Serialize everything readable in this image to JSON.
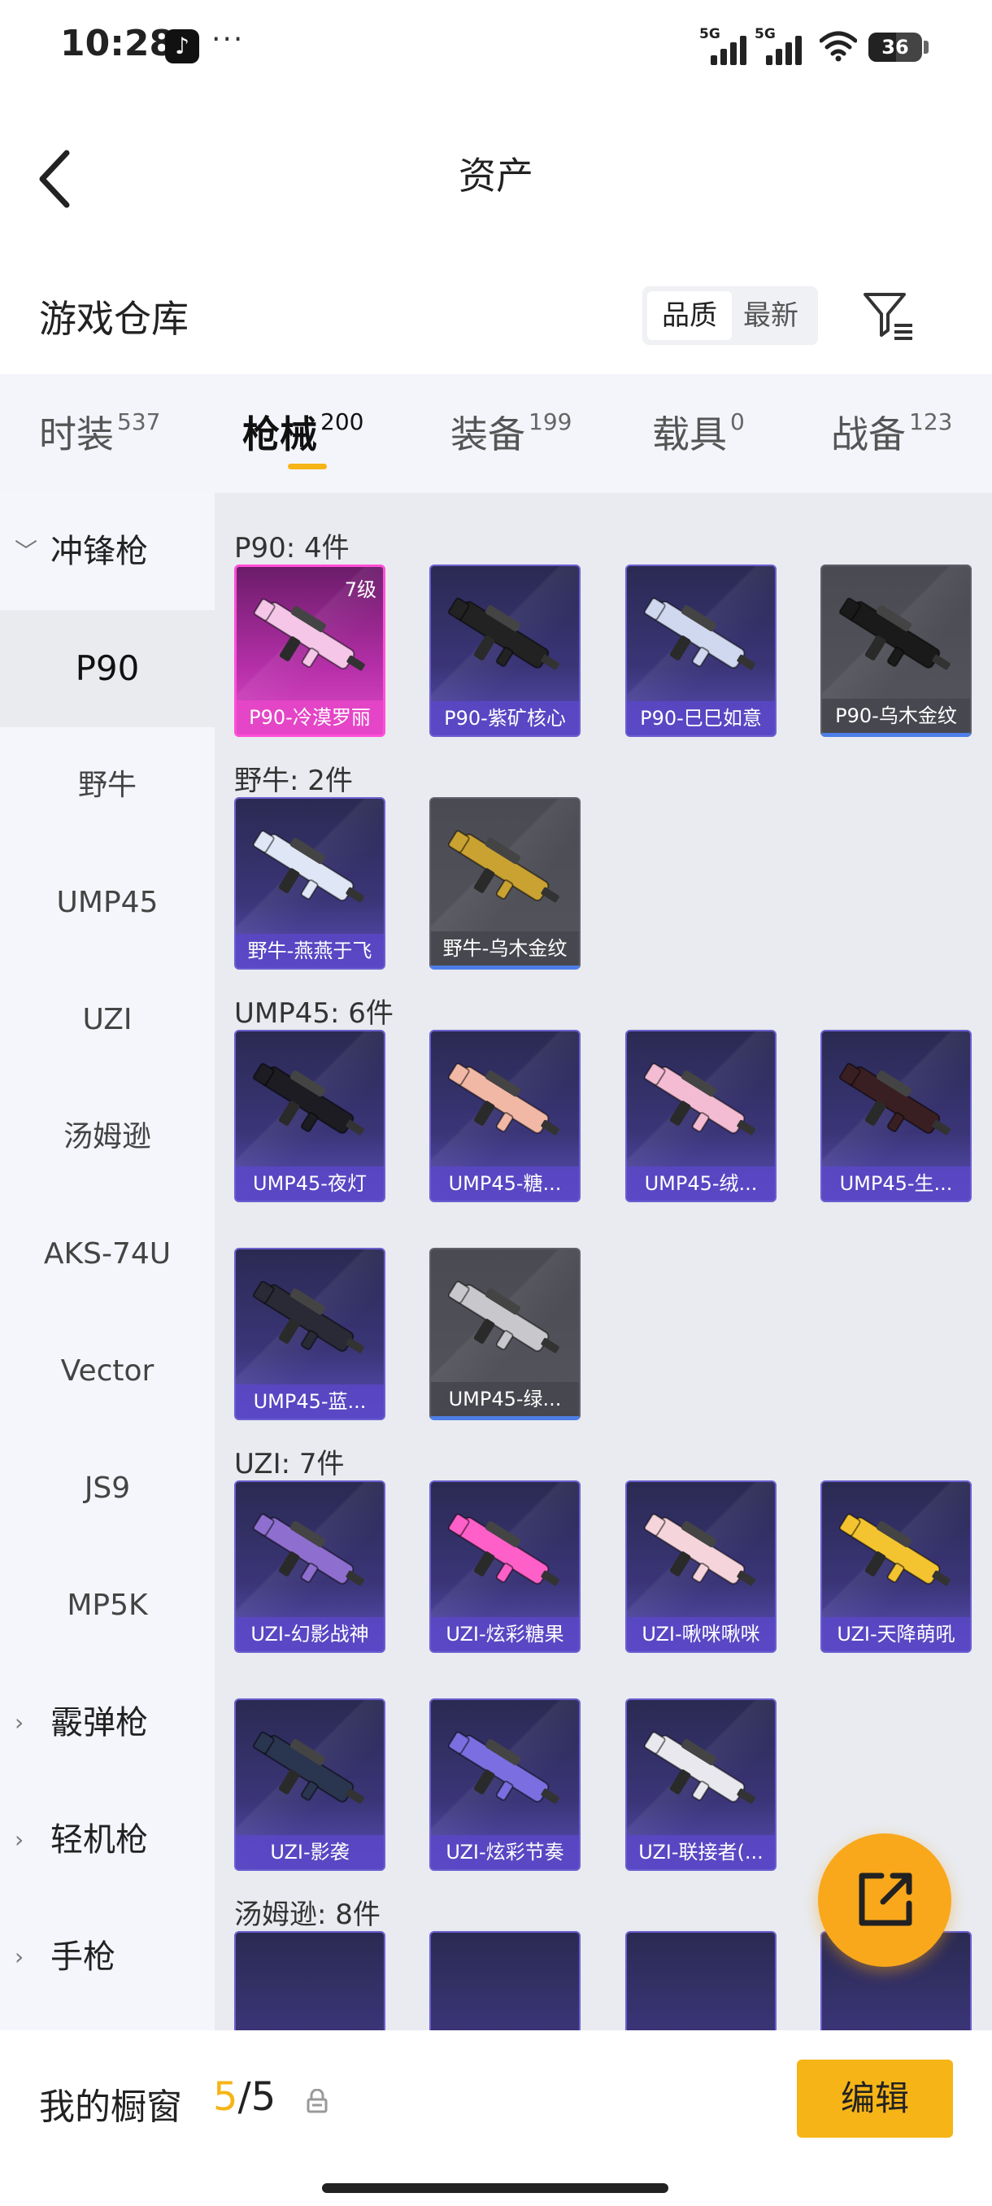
{
  "status_bar": {
    "time": "10:28",
    "more": "···",
    "network_1": "5G",
    "network_2": "5G",
    "battery": "36"
  },
  "header": {
    "title": "资产"
  },
  "warehouse": {
    "title": "游戏仓库",
    "sort_options": [
      "品质",
      "最新"
    ],
    "active_sort": "品质"
  },
  "tabs": [
    {
      "label": "时装",
      "count": "537"
    },
    {
      "label": "枪械",
      "count": "200"
    },
    {
      "label": "装备",
      "count": "199"
    },
    {
      "label": "载具",
      "count": "0"
    },
    {
      "label": "战备",
      "count": "123"
    }
  ],
  "active_tab": "枪械",
  "sidebar": {
    "group_open": "冲锋枪",
    "items": [
      "P90",
      "野牛",
      "UMP45",
      "UZI",
      "汤姆逊",
      "AKS-74U",
      "Vector",
      "JS9",
      "MP5K"
    ],
    "selected": "P90",
    "groups_closed": [
      "霰弹枪",
      "轻机枪",
      "手枪"
    ]
  },
  "sections": [
    {
      "title": "P90: 4件",
      "items": [
        {
          "name": "P90-冷漠罗丽",
          "level": "7级",
          "rarity": "pink",
          "color": "#f5c6e8"
        },
        {
          "name": "P90-紫矿核心",
          "rarity": "purple",
          "color": "#222222"
        },
        {
          "name": "P90-巳巳如意",
          "rarity": "purple",
          "color": "#cfd8ef"
        },
        {
          "name": "P90-乌木金纹",
          "rarity": "grey",
          "color": "#1a1a1a"
        }
      ]
    },
    {
      "title": "野牛: 2件",
      "items": [
        {
          "name": "野牛-燕燕于飞",
          "rarity": "purple",
          "color": "#dfe6f5"
        },
        {
          "name": "野牛-乌木金纹",
          "rarity": "grey",
          "color": "#c9a232"
        }
      ]
    },
    {
      "title": "UMP45: 6件",
      "items": [
        {
          "name": "UMP45-夜灯",
          "rarity": "purple",
          "color": "#1c1c22"
        },
        {
          "name": "UMP45-糖...",
          "rarity": "purple",
          "color": "#f2b8a6"
        },
        {
          "name": "UMP45-绒...",
          "rarity": "purple",
          "color": "#f4bcd3"
        },
        {
          "name": "UMP45-生...",
          "rarity": "purple",
          "color": "#3a1f22"
        },
        {
          "name": "UMP45-蓝...",
          "rarity": "purple",
          "color": "#2a2a36"
        },
        {
          "name": "UMP45-绿...",
          "rarity": "grey",
          "color": "#c8c8cc"
        }
      ]
    },
    {
      "title": "UZI: 7件",
      "items": [
        {
          "name": "UZI-幻影战神",
          "rarity": "purple",
          "color": "#8e6fd0"
        },
        {
          "name": "UZI-炫彩糖果",
          "rarity": "purple",
          "color": "#ff5fc8"
        },
        {
          "name": "UZI-啾咪啾咪",
          "rarity": "purple",
          "color": "#f6d4dc"
        },
        {
          "name": "UZI-天降萌吼",
          "rarity": "purple",
          "color": "#f4c430"
        },
        {
          "name": "UZI-影袭",
          "rarity": "purple",
          "color": "#2a3550"
        },
        {
          "name": "UZI-炫彩节奏",
          "rarity": "purple",
          "color": "#7b6ee0"
        },
        {
          "name": "UZI-联接者(...",
          "rarity": "purple",
          "color": "#e8e8ee"
        }
      ]
    },
    {
      "title": "汤姆逊: 8件",
      "items": []
    }
  ],
  "bottom_bar": {
    "label": "我的橱窗",
    "current": "5",
    "separator": "/",
    "total": "5",
    "edit_label": "编辑"
  },
  "colors": {
    "accent": "#f6b417",
    "fab": "#f9a81b",
    "rarity_purple": "#6b5fd0",
    "rarity_pink": "#ff4fd8",
    "rarity_grey": "#4d7ee8"
  },
  "icons": {
    "back": "chevron-left-icon",
    "filter": "filter-list-icon",
    "fab": "external-link-icon",
    "lock": "lock-icon"
  }
}
